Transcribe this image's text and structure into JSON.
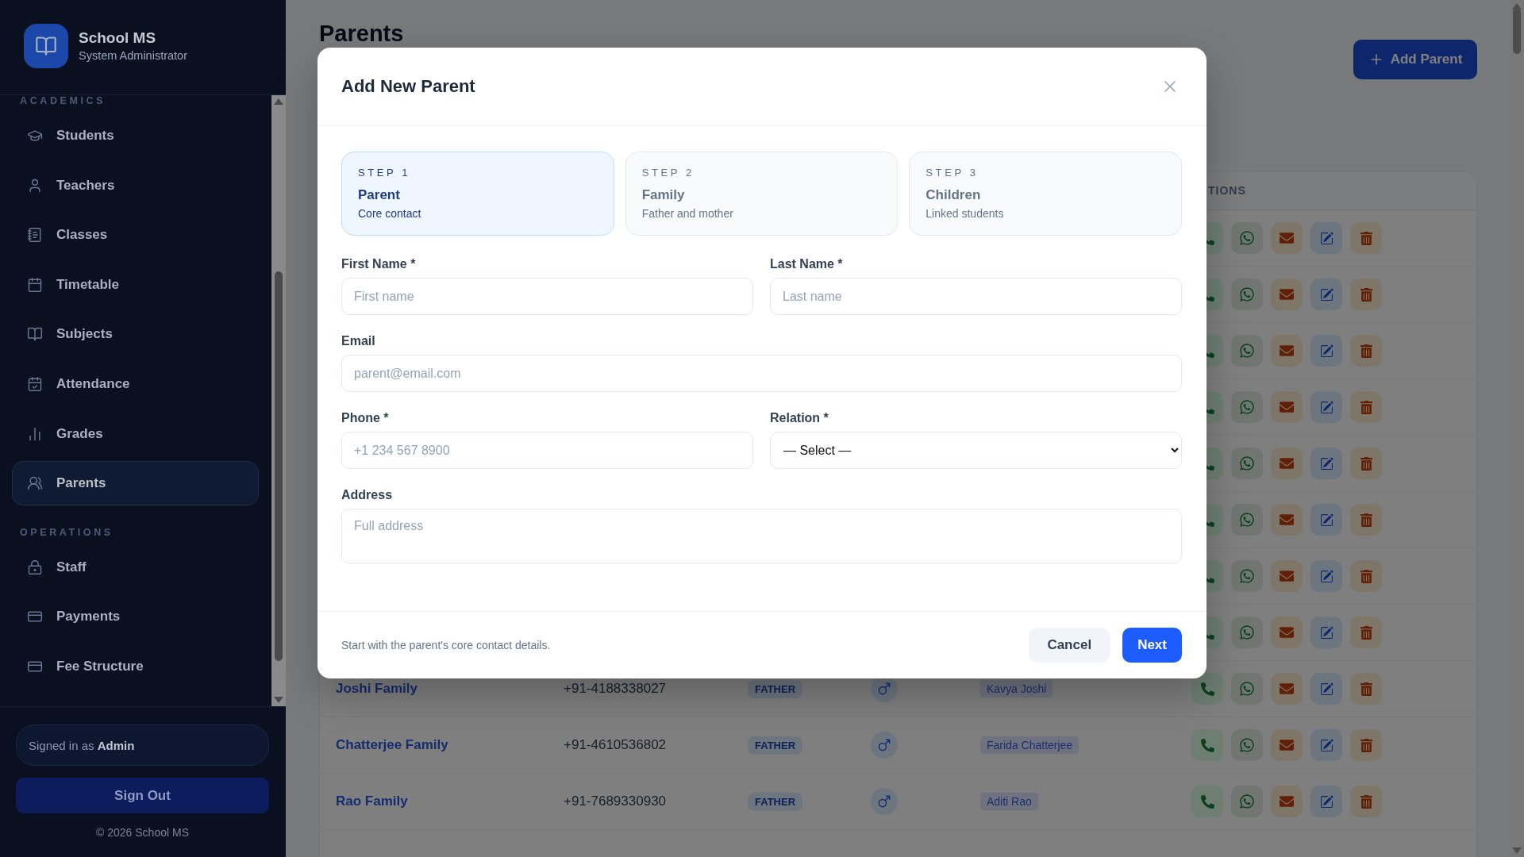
{
  "sidebar": {
    "brand": {
      "title": "School MS",
      "subtitle": "System Administrator"
    },
    "sections": [
      {
        "label": "ACADEMICS",
        "items": [
          {
            "label": "Students",
            "selected": false
          },
          {
            "label": "Teachers",
            "selected": false
          },
          {
            "label": "Classes",
            "selected": false
          },
          {
            "label": "Timetable",
            "selected": false
          },
          {
            "label": "Subjects",
            "selected": false
          },
          {
            "label": "Attendance",
            "selected": false
          },
          {
            "label": "Grades",
            "selected": false
          },
          {
            "label": "Parents",
            "selected": true
          }
        ]
      },
      {
        "label": "OPERATIONS",
        "items": [
          {
            "label": "Staff",
            "selected": false
          },
          {
            "label": "Payments",
            "selected": false
          },
          {
            "label": "Fee Structure",
            "selected": false
          }
        ]
      }
    ],
    "signed_in": "Signed in as **Admin**",
    "sign_out": "Sign Out",
    "copyright": "© 2026 School MS"
  },
  "page": {
    "title": "Parents",
    "add_button": "Add Parent"
  },
  "table": {
    "columns": [
      {
        "label": "TIONS"
      }
    ],
    "rows": [
      {
        "kind": "covered"
      },
      {
        "kind": "covered"
      },
      {
        "kind": "covered"
      },
      {
        "kind": "covered"
      },
      {
        "kind": "covered"
      },
      {
        "kind": "covered"
      },
      {
        "kind": "covered"
      },
      {
        "kind": "covered"
      },
      {
        "kind": "family",
        "name": "Joshi Family",
        "phone": "+91-4188338027",
        "relation": "FATHER",
        "student": "Kavya Joshi"
      },
      {
        "kind": "family",
        "name": "Chatterjee Family",
        "phone": "+91-4610536802",
        "relation": "FATHER",
        "student": "Farida Chatterjee"
      },
      {
        "kind": "family",
        "name": "Rao Family",
        "phone": "+91-7689330930",
        "relation": "FATHER",
        "student": "Aditi Rao"
      }
    ]
  },
  "modal": {
    "title": "Add New Parent",
    "steps": [
      {
        "step": "STEP 1",
        "title": "Parent",
        "subtitle": "Core contact",
        "selected": true
      },
      {
        "step": "STEP 2",
        "title": "Family",
        "subtitle": "Father and mother",
        "selected": false
      },
      {
        "step": "STEP 3",
        "title": "Children",
        "subtitle": "Linked students",
        "selected": false
      }
    ],
    "form_rows": [
      {
        "fields": [
          {
            "kind": "input",
            "label": "First Name *",
            "placeholder": "First name"
          },
          {
            "kind": "input",
            "label": "Last Name *",
            "placeholder": "Last name"
          }
        ]
      },
      {
        "fields": [
          {
            "kind": "input",
            "label": "Email",
            "placeholder": "parent@email.com"
          }
        ]
      },
      {
        "fields": [
          {
            "kind": "input",
            "label": "Phone *",
            "placeholder": "+1 234 567 8900"
          },
          {
            "kind": "select",
            "label": "Relation *",
            "value": "— Select —"
          }
        ]
      },
      {
        "fields": [
          {
            "kind": "textarea",
            "label": "Address",
            "placeholder": "Full address"
          }
        ]
      }
    ],
    "hint": "Start with the parent's core contact details.",
    "buttons": [
      {
        "kind": "secondary",
        "label": "Cancel"
      },
      {
        "kind": "primary",
        "label": "Next"
      }
    ]
  }
}
